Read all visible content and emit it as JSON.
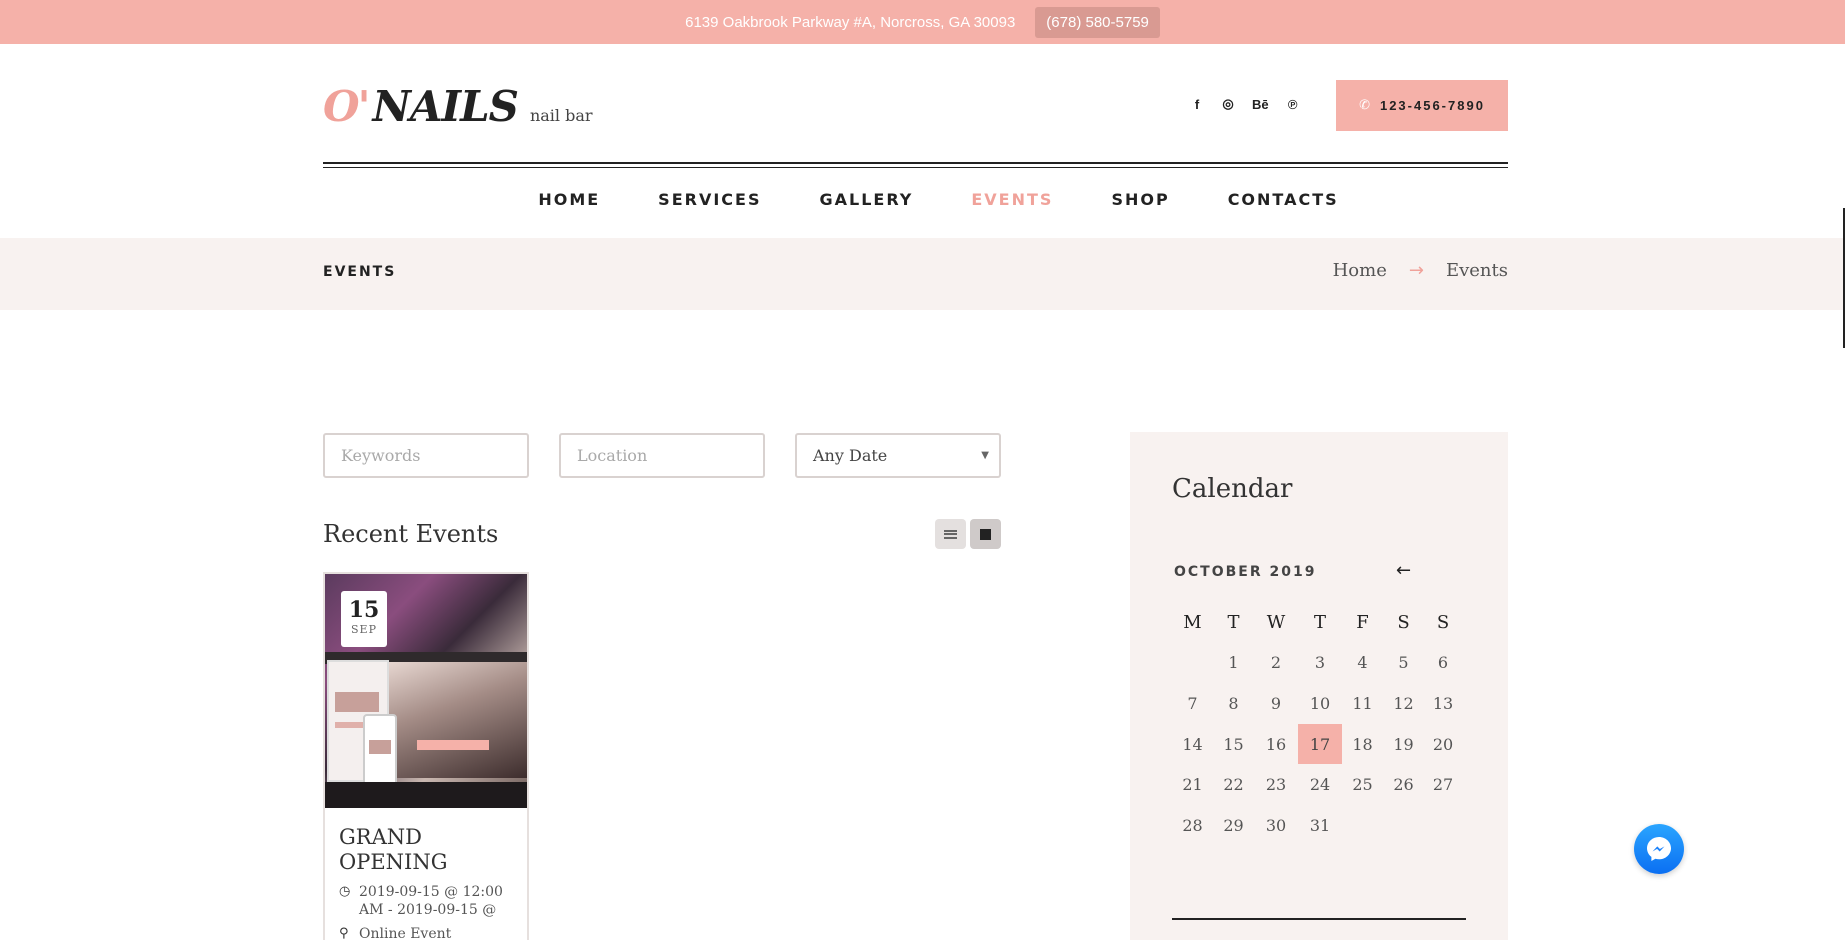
{
  "topbar": {
    "address": "6139 Oakbrook Parkway #A, Norcross, GA 30093",
    "phone": "(678) 580-5759"
  },
  "header": {
    "logo_o": "O",
    "logo_apostrophe": "'",
    "logo_nails": "NAILS",
    "logo_tagline": "nail bar",
    "socials": [
      {
        "icon": "facebook-icon",
        "label": "f"
      },
      {
        "icon": "instagram-icon",
        "label": "◎"
      },
      {
        "icon": "behance-icon",
        "label": "Bē"
      },
      {
        "icon": "pinterest-icon",
        "label": "℗"
      }
    ],
    "call_number": "123-456-7890"
  },
  "nav": {
    "items": [
      "HOME",
      "SERVICES",
      "GALLERY",
      "EVENTS",
      "SHOP",
      "CONTACTS"
    ],
    "active": "EVENTS"
  },
  "breadcrumb": {
    "page_title": "EVENTS",
    "home": "Home",
    "separator": "→",
    "current": "Events"
  },
  "filters": {
    "keywords_placeholder": "Keywords",
    "location_placeholder": "Location",
    "date_selected": "Any Date"
  },
  "events": {
    "heading": "Recent Events",
    "items": [
      {
        "day": "15",
        "month": "SEP",
        "title": "GRAND OPENING",
        "time": "2019-09-15 @ 12:00 AM - 2019-09-15 @",
        "location": "Online Event"
      }
    ]
  },
  "calendar": {
    "title": "Calendar",
    "month_label": "OCTOBER 2019",
    "prev_arrow": "←",
    "weekdays": [
      "M",
      "T",
      "W",
      "T",
      "F",
      "S",
      "S"
    ],
    "start_offset": 1,
    "days_in_month": 31,
    "today": 17
  },
  "colors": {
    "accent": "#f5b1a9",
    "accent_text": "#f0a29a",
    "panel_bg": "#f8f2f0",
    "dark": "#222222"
  }
}
